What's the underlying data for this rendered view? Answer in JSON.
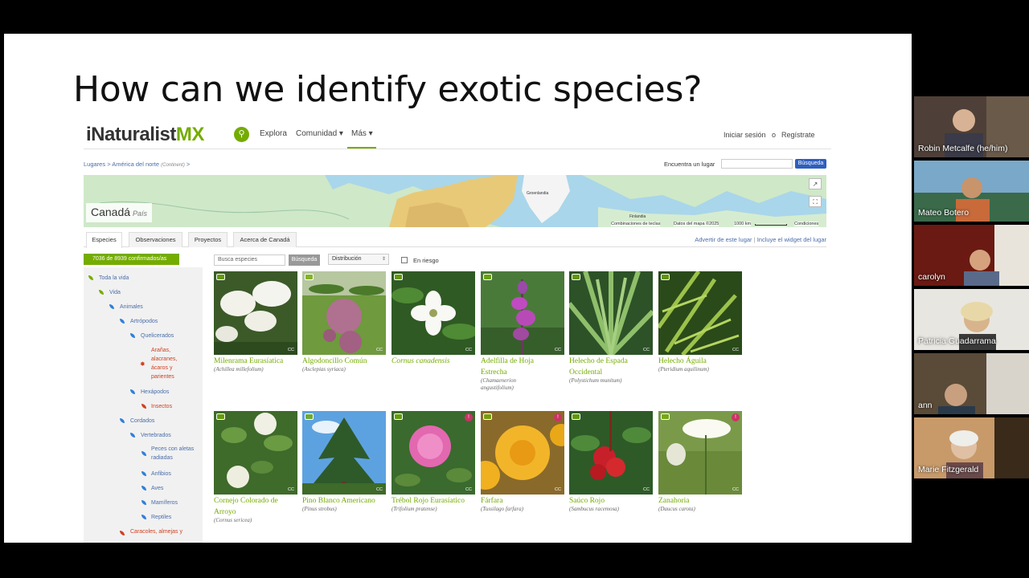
{
  "slide": {
    "title": "How can we identify exotic species?"
  },
  "site": {
    "logo_main": "iNaturalist",
    "logo_accent": "MX",
    "nav": [
      "Explora",
      "Comunidad ▾",
      "Más ▾"
    ],
    "login": "Iniciar sesión",
    "or": "o",
    "register": "Regístrate"
  },
  "breadcrumb": {
    "lugares": "Lugares",
    "sep1": ">",
    "america": "América del norte",
    "continent": "(Continent)",
    "sep2": ">"
  },
  "find_place": {
    "label": "Encuentra un lugar",
    "button": "Búsqueda"
  },
  "map": {
    "place_name": "Canadá",
    "place_type": "País",
    "label_groenlandia": "Groenlandia",
    "label_finlandia": "Finlandia",
    "footer": [
      "Combinaciones de teclas",
      "Datos del mapa ©2025",
      "1000 km",
      "Condiciones"
    ]
  },
  "tabs": [
    "Especies",
    "Observaciones",
    "Proyectos",
    "Acerca de Canadá"
  ],
  "tab_links": {
    "warn": "Advertir de este lugar",
    "sep": "|",
    "widget": "Incluye el widget del lugar"
  },
  "confirmed": "7036 de 8939 confirmados/as",
  "tree": [
    "Toda la vida",
    "Vida",
    "Animales",
    "Artrópodos",
    "Quelicerados",
    "Arañas,",
    "alacranes,",
    "ácaros y",
    "parientes",
    "Hexápodos",
    "Insectos",
    "Cordados",
    "Vertebrados",
    "Peces con aletas",
    "radiadas",
    "Anfibios",
    "Aves",
    "Mamíferos",
    "Reptiles",
    "Caracoles, almejas y"
  ],
  "filters": {
    "search_placeholder": "Busca especies",
    "search_button": "Búsqueda",
    "distribution": "Distribución",
    "risk": "En riesgo"
  },
  "species": [
    {
      "common": "Milenrama Eurasíatica",
      "sci": "(Achillea millefolium)"
    },
    {
      "common": "Algodoncillo Común",
      "sci": "(Asclepias syriaca)"
    },
    {
      "common": "Cornus canadensis",
      "sci": ""
    },
    {
      "common": "Adelfilla de Hoja",
      "common2": "Estrecha",
      "sci": "(Chamaenerion",
      "sci2": "angustifolium)"
    },
    {
      "common": "Helecho de Espada",
      "common2": "Occidental",
      "sci": "(Polystichum munitum)"
    },
    {
      "common": "Helecho Águila",
      "sci": "(Pteridium aquilinum)"
    },
    {
      "common": "Cornejo Colorado de",
      "common2": "Arroyo",
      "sci": "(Cornus sericea)"
    },
    {
      "common": "Pino Blanco Americano",
      "sci": "(Pinus strobus)"
    },
    {
      "common": "Trébol Rojo Eurasíatico",
      "sci": "(Trifolium pratense)"
    },
    {
      "common": "Fárfara",
      "sci": "(Tussilago farfara)"
    },
    {
      "common": "Saúco Rojo",
      "sci": "(Sambucus racemosa)"
    },
    {
      "common": "Zanahoria",
      "sci": "(Daucus carota)"
    }
  ],
  "cc": "CC",
  "participants": [
    "Robin Metcalfe (he/him)",
    "Mateo Botero",
    "carolyn",
    "Patricia Guadarrama",
    "ann",
    "Marie Fitzgerald"
  ]
}
